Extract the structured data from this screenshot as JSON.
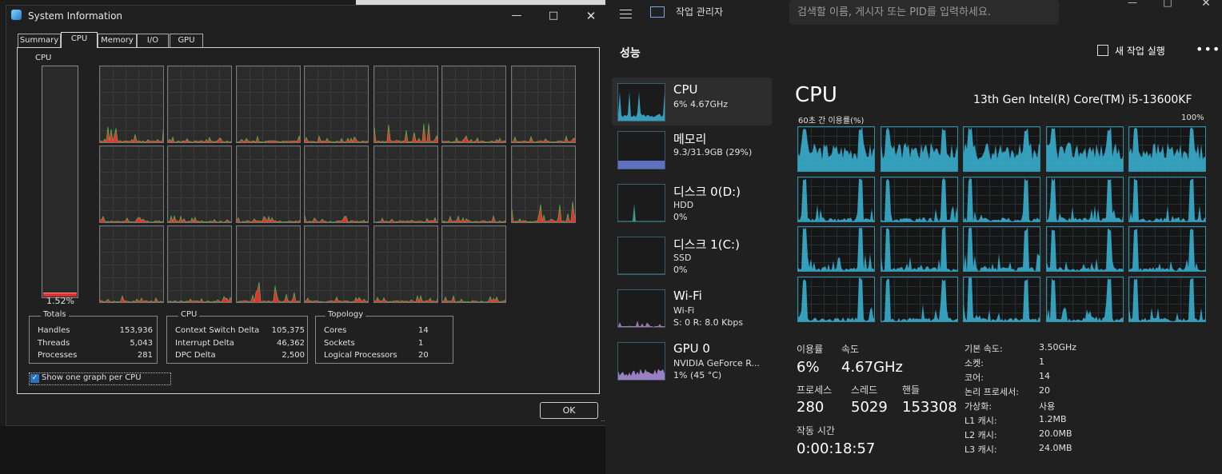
{
  "system_info": {
    "title": "System Information",
    "tabs": [
      "Summary",
      "CPU",
      "Memory",
      "I/O",
      "GPU"
    ],
    "active_tab": "CPU",
    "cpu_label": "CPU",
    "cpu_usage_pct": "1.52%",
    "cpu_usage_value": 1.52,
    "totals": {
      "title": "Totals",
      "rows": [
        {
          "label": "Handles",
          "value": "153,936"
        },
        {
          "label": "Threads",
          "value": "5,043"
        },
        {
          "label": "Processes",
          "value": "281"
        }
      ]
    },
    "cpu_group": {
      "title": "CPU",
      "rows": [
        {
          "label": "Context Switch Delta",
          "value": "105,375"
        },
        {
          "label": "Interrupt Delta",
          "value": "46,362"
        },
        {
          "label": "DPC Delta",
          "value": "2,500"
        }
      ]
    },
    "topology": {
      "title": "Topology",
      "rows": [
        {
          "label": "Cores",
          "value": "14"
        },
        {
          "label": "Sockets",
          "value": "1"
        },
        {
          "label": "Logical Processors",
          "value": "20"
        }
      ]
    },
    "show_one_graph_label": "Show one graph per CPU",
    "show_one_graph_checked": true,
    "ok_label": "OK",
    "cpu_graph_count": 20
  },
  "task_manager": {
    "title": "작업 관리자",
    "search_placeholder": "검색할 이름, 게시자 또는 PID를 입력하세요.",
    "section": "성능",
    "run_task": "새 작업 실행",
    "sidebar": [
      {
        "name": "CPU",
        "line1": "6% 4.67GHz",
        "line2": ""
      },
      {
        "name": "메모리",
        "line1": "9.3/31.9GB (29%)",
        "line2": ""
      },
      {
        "name": "디스크 0(D:)",
        "line1": "HDD",
        "line2": "0%"
      },
      {
        "name": "디스크 1(C:)",
        "line1": "SSD",
        "line2": "0%"
      },
      {
        "name": "Wi-Fi",
        "line1": "Wi-Fi",
        "line2": "S: 0 R: 8.0 Kbps"
      },
      {
        "name": "GPU 0",
        "line1": "NVIDIA GeForce R...",
        "line2": "1% (45 °C)"
      }
    ],
    "main_title": "CPU",
    "cpu_model": "13th Gen Intel(R) Core(TM) i5-13600KF",
    "graph_label": "60초 간 이용률(%)",
    "graph_max": "100%",
    "stats": {
      "usage_label": "이용률",
      "usage": "6%",
      "speed_label": "속도",
      "speed": "4.67GHz",
      "proc_label": "프로세스",
      "proc": "280",
      "thread_label": "스레드",
      "thread": "5029",
      "handle_label": "핸들",
      "handle": "153308",
      "uptime_label": "작동 시간",
      "uptime": "0:00:18:57"
    },
    "specs": [
      {
        "k": "기본 속도:",
        "v": "3.50GHz"
      },
      {
        "k": "소켓:",
        "v": "1"
      },
      {
        "k": "코어:",
        "v": "14"
      },
      {
        "k": "논리 프로세서:",
        "v": "20"
      },
      {
        "k": "가상화:",
        "v": "사용"
      },
      {
        "k": "L1 캐시:",
        "v": "1.2MB"
      },
      {
        "k": "L2 캐시:",
        "v": "20.0MB"
      },
      {
        "k": "L3 캐시:",
        "v": "24.0MB"
      }
    ],
    "accent": "#3ab6d8"
  }
}
